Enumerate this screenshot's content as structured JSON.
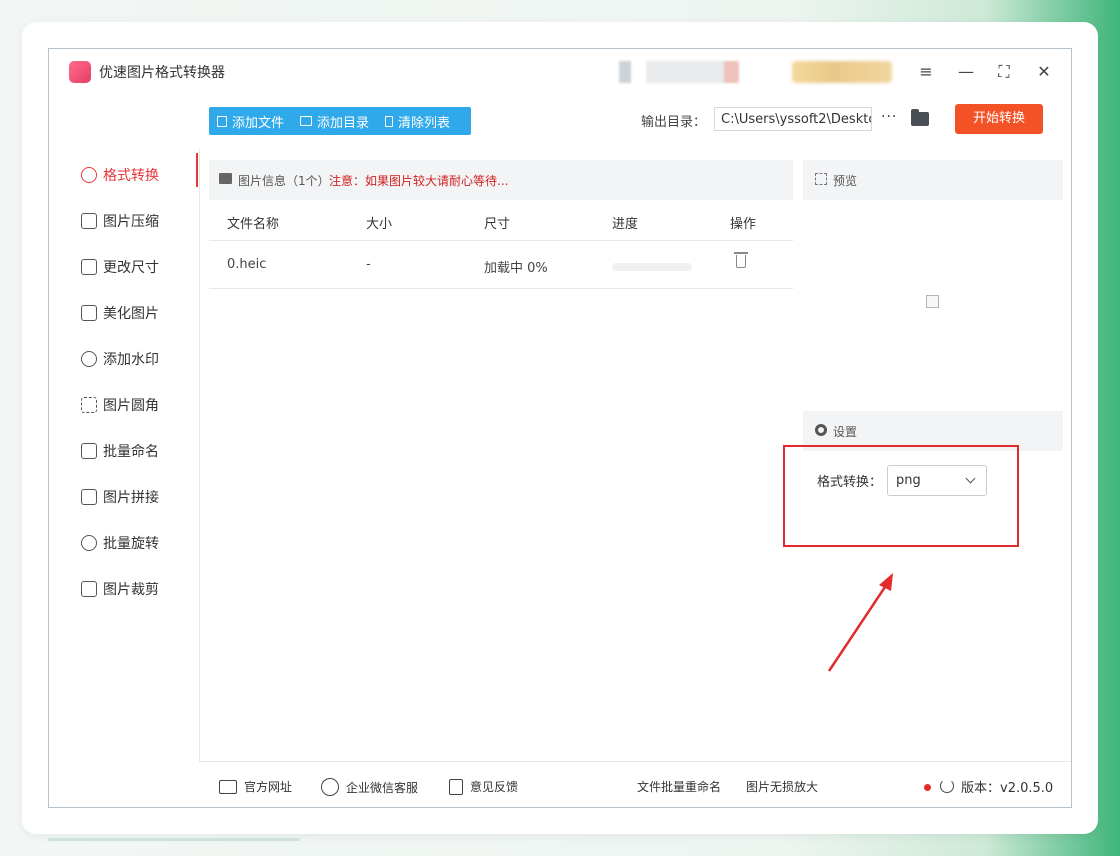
{
  "app": {
    "title": "优速图片格式转换器"
  },
  "toolbar": {
    "add_file": "添加文件",
    "add_folder": "添加目录",
    "clear_list": "清除列表",
    "output_label": "输出目录：",
    "output_path": "C:\\Users\\yssoft2\\Deskto",
    "more": "···",
    "start": "开始转换"
  },
  "sidebar": {
    "items": [
      {
        "label": "格式转换",
        "icon": "convert-icon",
        "active": true
      },
      {
        "label": "图片压缩",
        "icon": "compress-icon"
      },
      {
        "label": "更改尺寸",
        "icon": "resize-icon"
      },
      {
        "label": "美化图片",
        "icon": "beautify-icon"
      },
      {
        "label": "添加水印",
        "icon": "watermark-icon"
      },
      {
        "label": "图片圆角",
        "icon": "round-corner-icon"
      },
      {
        "label": "批量命名",
        "icon": "rename-icon"
      },
      {
        "label": "图片拼接",
        "icon": "stitch-icon"
      },
      {
        "label": "批量旋转",
        "icon": "rotate-icon"
      },
      {
        "label": "图片裁剪",
        "icon": "crop-icon"
      }
    ]
  },
  "file_panel": {
    "info_label": "图片信息（1个）",
    "notice": "注意：如果图片较大请耐心等待...",
    "columns": [
      "文件名称",
      "大小",
      "尺寸",
      "进度",
      "操作"
    ],
    "rows": [
      {
        "name": "0.heic",
        "size": "-",
        "dimensions": "加载中 0%",
        "progress": 0
      }
    ]
  },
  "preview": {
    "label": "预览"
  },
  "settings": {
    "label": "设置",
    "format_label": "格式转换：",
    "format_value": "png"
  },
  "footer": {
    "website": "官方网址",
    "wechat": "企业微信客服",
    "feedback": "意见反馈",
    "batch_rename": "文件批量重命名",
    "lossless_zoom": "图片无损放大",
    "version": "版本：v2.0.5.0"
  },
  "colors": {
    "accent_red": "#e8353a",
    "toolbar_blue": "#2fa9ea",
    "start_orange": "#f35226",
    "highlight_red": "#e42b2b"
  }
}
